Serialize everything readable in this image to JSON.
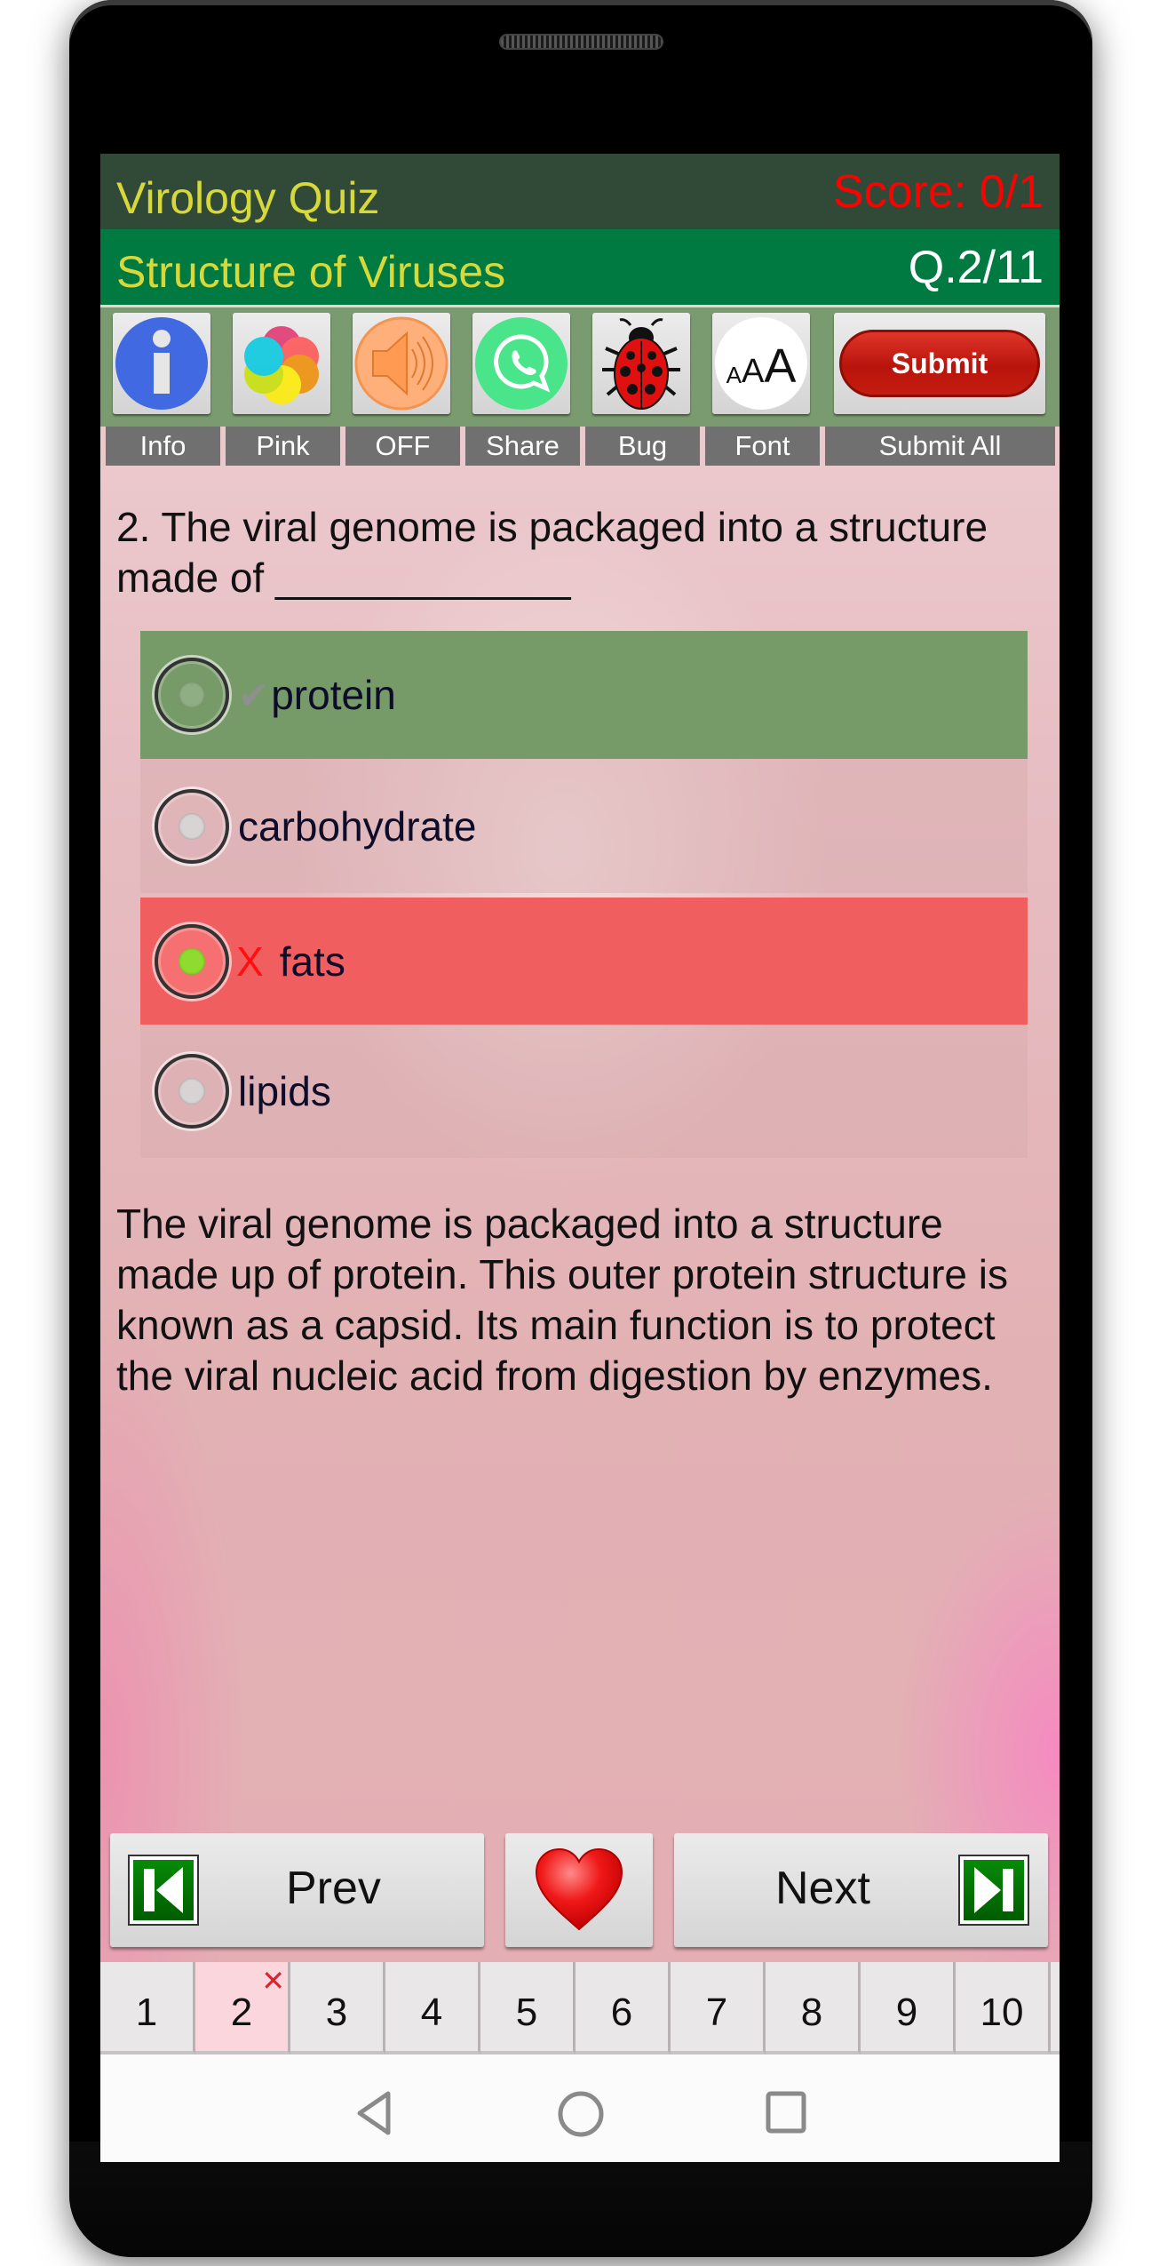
{
  "header": {
    "app_title": "Virology Quiz",
    "score": "Score: 0/1",
    "topic": "Structure of Viruses",
    "question_counter": "Q.2/11"
  },
  "toolbar": {
    "buttons": [
      {
        "icon": "info-icon",
        "label": "Info"
      },
      {
        "icon": "theme-color-icon",
        "label": "Pink"
      },
      {
        "icon": "speaker-icon",
        "label": "OFF"
      },
      {
        "icon": "whatsapp-share-icon",
        "label": "Share"
      },
      {
        "icon": "ladybug-icon",
        "label": "Bug"
      },
      {
        "icon": "font-size-icon",
        "label": "Font",
        "glyph_small": "A",
        "glyph_mid": "A",
        "glyph_large": "A"
      }
    ],
    "submit_label": "Submit",
    "submit_all_label": "Submit All"
  },
  "question": {
    "text": "2. The viral genome is packaged into a structure made of _____________"
  },
  "options": [
    {
      "text": "protein",
      "mark": "✔",
      "state": "correct",
      "selected": false
    },
    {
      "text": "carbohydrate",
      "mark": "",
      "state": "neutral",
      "selected": false
    },
    {
      "text": "fats",
      "mark": "X",
      "state": "wrong",
      "selected": true
    },
    {
      "text": "lipids",
      "mark": "",
      "state": "neutral",
      "selected": false
    }
  ],
  "explanation": "The viral genome is packaged into a structure made up of protein. This outer protein structure is known as a capsid. Its main function is to protect the viral nucleic acid from digestion by enzymes.",
  "navigation": {
    "prev_label": "Prev",
    "next_label": "Next",
    "favorite_icon": "heart-icon"
  },
  "question_tabs": [
    {
      "label": "1",
      "status": ""
    },
    {
      "label": "2",
      "status": "wrong",
      "marker": "✕"
    },
    {
      "label": "3",
      "status": ""
    },
    {
      "label": "4",
      "status": ""
    },
    {
      "label": "5",
      "status": ""
    },
    {
      "label": "6",
      "status": ""
    },
    {
      "label": "7",
      "status": ""
    },
    {
      "label": "8",
      "status": ""
    },
    {
      "label": "9",
      "status": ""
    },
    {
      "label": "10",
      "status": ""
    }
  ],
  "colors": {
    "title_bar": "#314a38",
    "subtitle_bar": "#007a40",
    "title_text": "#d7d83a",
    "score_text": "#ff0000",
    "toolbar_bg": "#7a9a70",
    "correct_option": "#779a69",
    "wrong_option": "#f15e60",
    "active_tab": "#fbd6dc"
  }
}
